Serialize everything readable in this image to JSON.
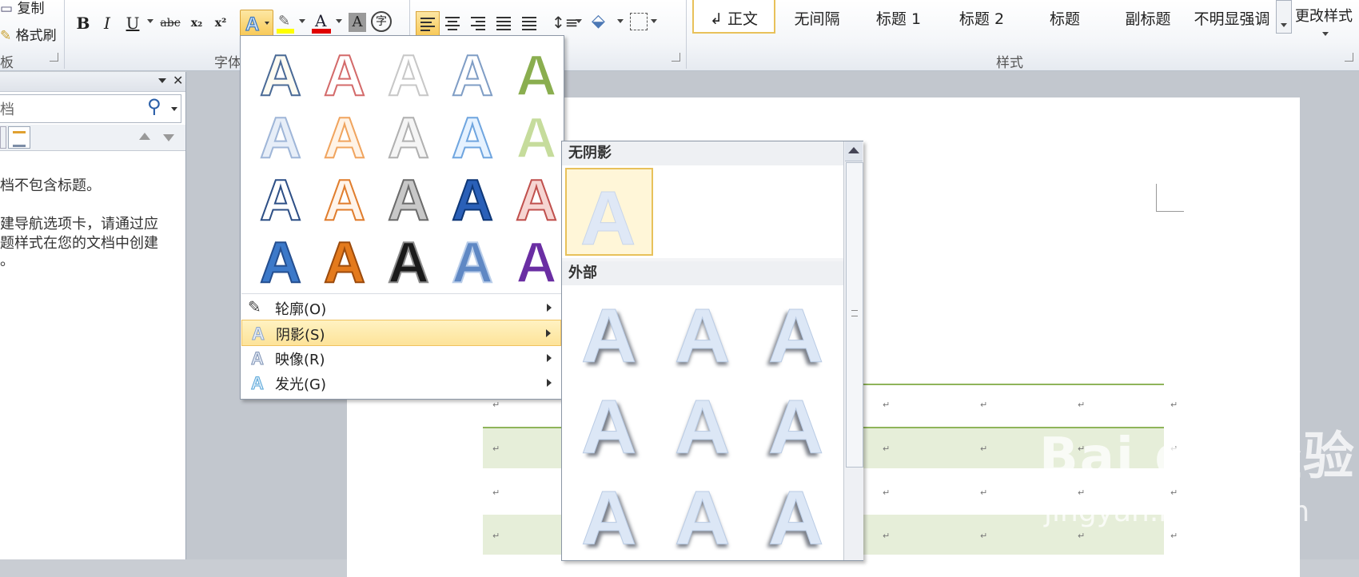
{
  "clipboard": {
    "copy": "复制",
    "format_painter": "格式刷",
    "group_label": "板"
  },
  "font_group": {
    "label": "字体",
    "bold": "B",
    "italic": "I",
    "underline": "U",
    "strike": "abc",
    "subscript": "x₂",
    "superscript": "x²"
  },
  "styles_group": {
    "label": "样式",
    "items": [
      "↲ 正文",
      "无间隔",
      "标题 1",
      "标题 2",
      "标题",
      "副标题",
      "不明显强调"
    ],
    "change_styles": "更改样式"
  },
  "nav_pane": {
    "search_placeholder": "档",
    "message_line1": "档不包含标题。",
    "message_line2": "建导航选项卡，请通过应",
    "message_line3": "题样式在您的文档中创建",
    "message_line4": "。"
  },
  "gallery_menu": {
    "outline": "轮廓(O)",
    "shadow": "阴影(S)",
    "reflection": "映像(R)",
    "glow": "发光(G)"
  },
  "shadow_menu": {
    "no_shadow": "无阴影",
    "outer": "外部"
  },
  "watermark": {
    "logo": "Bai du 经验",
    "url": "jingyan.baidu.com"
  },
  "colors": {
    "accent_gold": "#f8c957",
    "table_green": "#8fb45a",
    "shade": "#e6eed9"
  }
}
